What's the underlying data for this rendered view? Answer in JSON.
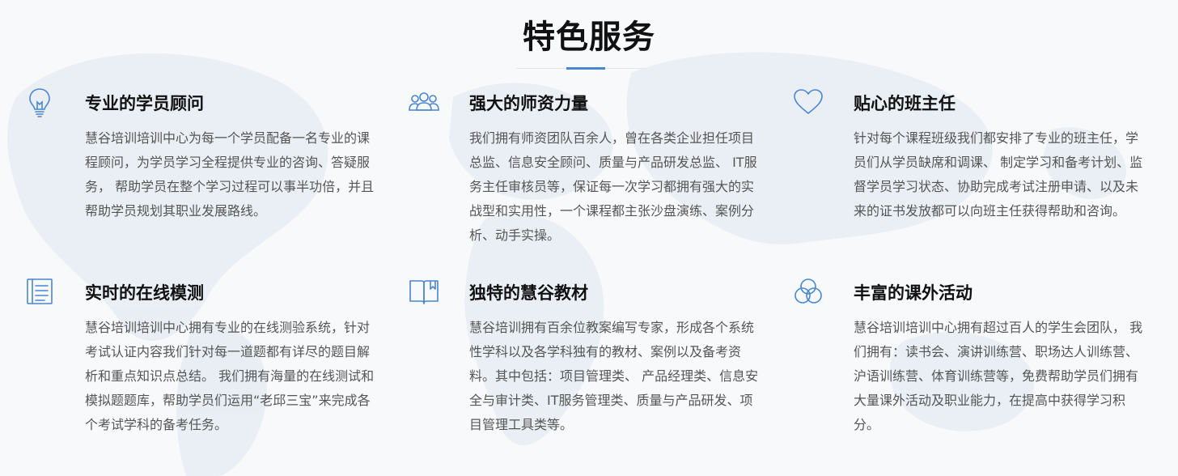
{
  "section": {
    "title": "特色服务"
  },
  "colors": {
    "accent": "#4a86d0",
    "heading": "#111111",
    "body_text": "#555555"
  },
  "features": [
    {
      "icon": "lightbulb-icon",
      "title": "专业的学员顾问",
      "text": "慧谷培训培训中心为每一个学员配备一名专业的课程顾问，为学员学习全程提供专业的咨询、答疑服务， 帮助学员在整个学习过程可以事半功倍，并且帮助学员规划其职业发展路线。"
    },
    {
      "icon": "users-group-icon",
      "title": "强大的师资力量",
      "text": "我们拥有师资团队百余人，曾在各类企业担任项目总监、信息安全顾问、质量与产品研发总监、 IT服务主任审核员等，保证每一次学习都拥有强大的实战型和实用性，一个课程都主张沙盘演练、案例分析、动手实操。"
    },
    {
      "icon": "heart-icon",
      "title": "贴心的班主任",
      "text": "针对每个课程班级我们都安排了专业的班主任，学员们从学员缺席和调课、 制定学习和备考计划、监督学员学习状态、协助完成考试注册申请、以及未来的证书发放都可以向班主任获得帮助和咨询。"
    },
    {
      "icon": "document-list-icon",
      "title": "实时的在线模测",
      "text": "慧谷培训培训中心拥有专业的在线测验系统，针对考试认证内容我们针对每一道题都有详尽的题目解析和重点知识点总结。 我们拥有海量的在线测试和模拟题题库，帮助学员们运用“老邱三宝”来完成各个考试学科的备考任务。"
    },
    {
      "icon": "open-book-icon",
      "title": "独特的慧谷教材",
      "text": "慧谷培训拥有百余位教案编写专家，形成各个系统性学科以及各学科独有的教材、案例以及备考资料。其中包括：项目管理类、 产品经理类、信息安全与审计类、IT服务管理类、质量与产品研发、项目管理工具类等。"
    },
    {
      "icon": "three-circles-icon",
      "title": "丰富的课外活动",
      "text": "慧谷培训培训中心拥有超过百人的学生会团队， 我们拥有：读书会、演讲训练营、职场达人训练营、沪语训练营、体育训练营等，免费帮助学员们拥有大量课外活动及职业能力，在提高中获得学习积分。"
    }
  ]
}
